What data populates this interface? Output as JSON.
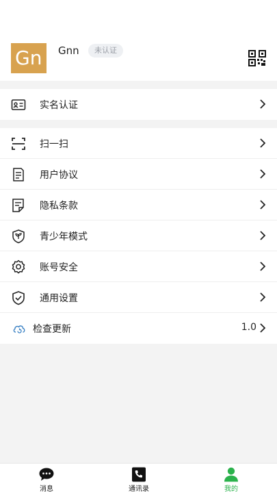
{
  "profile": {
    "avatar_text": "Gn",
    "username": "Gnn",
    "verify_badge": "未认证",
    "qr_icon": "qr-code-icon",
    "avatar_color": "#d8a24f"
  },
  "sections": {
    "verification": [
      {
        "label": "实名认证",
        "icon": "id-card-icon"
      }
    ],
    "menu": [
      {
        "label": "扫一扫",
        "icon": "scan-icon"
      },
      {
        "label": "用户协议",
        "icon": "document-icon"
      },
      {
        "label": "隐私条款",
        "icon": "privacy-document-icon"
      },
      {
        "label": "青少年模式",
        "icon": "youth-shield-icon"
      },
      {
        "label": "账号安全",
        "icon": "gear-icon"
      },
      {
        "label": "通用设置",
        "icon": "shield-check-icon"
      }
    ],
    "update": {
      "label": "检查更新",
      "version": "1.0",
      "icon": "cloud-refresh-icon"
    }
  },
  "tabbar": {
    "items": [
      {
        "label": "消息",
        "icon": "chat-bubble-icon",
        "active": false
      },
      {
        "label": "通讯录",
        "icon": "phone-icon",
        "active": false
      },
      {
        "label": "我的",
        "icon": "user-icon",
        "active": true
      }
    ],
    "active_color": "#2bb24c"
  }
}
